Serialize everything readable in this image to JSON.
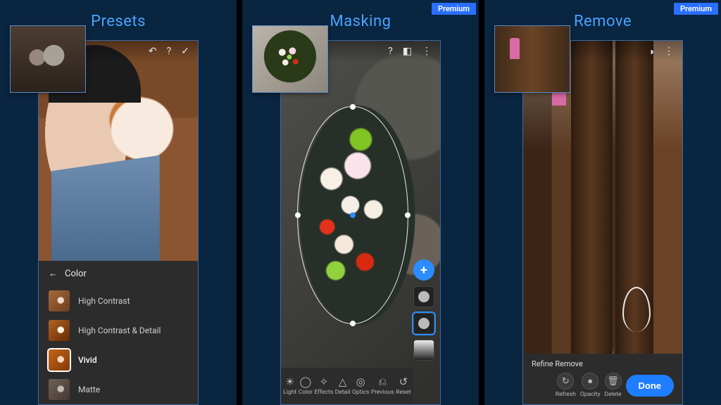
{
  "panels": [
    {
      "title": "Presets",
      "premium": false,
      "topbar": {
        "undo": "↶",
        "help": "?",
        "accept": "✓"
      },
      "preset_header": {
        "back": "←",
        "label": "Color"
      },
      "presets": [
        {
          "label": "High Contrast",
          "selected": false
        },
        {
          "label": "High Contrast & Detail",
          "selected": false
        },
        {
          "label": "Vivid",
          "selected": true
        },
        {
          "label": "Matte",
          "selected": false
        }
      ]
    },
    {
      "title": "Masking",
      "premium": true,
      "premium_label": "Premium",
      "topbar": {
        "help": "?",
        "invert": "◧",
        "more": "⋮"
      },
      "add_label": "+",
      "mask_chips": [
        {
          "kind": "blob",
          "selected": false
        },
        {
          "kind": "blob",
          "selected": true
        },
        {
          "kind": "grad",
          "selected": false
        }
      ],
      "tools": [
        {
          "label": "Light",
          "glyph": "☀"
        },
        {
          "label": "Color",
          "glyph": "◯"
        },
        {
          "label": "Effects",
          "glyph": "✧"
        },
        {
          "label": "Detail",
          "glyph": "△"
        },
        {
          "label": "Optics",
          "glyph": "◎"
        },
        {
          "label": "Previous",
          "glyph": "⎌"
        },
        {
          "label": "Reset",
          "glyph": "↺"
        }
      ]
    },
    {
      "title": "Remove",
      "premium": true,
      "premium_label": "Premium",
      "topbar": {
        "preview": "◑",
        "more": "⋮"
      },
      "tabs": "Refine  Remove",
      "controls": [
        {
          "label": "Refresh",
          "glyph": "↻"
        },
        {
          "label": "Opacity",
          "glyph": "●"
        },
        {
          "label": "Delete",
          "glyph": "🗑"
        }
      ],
      "done_label": "Done"
    }
  ]
}
